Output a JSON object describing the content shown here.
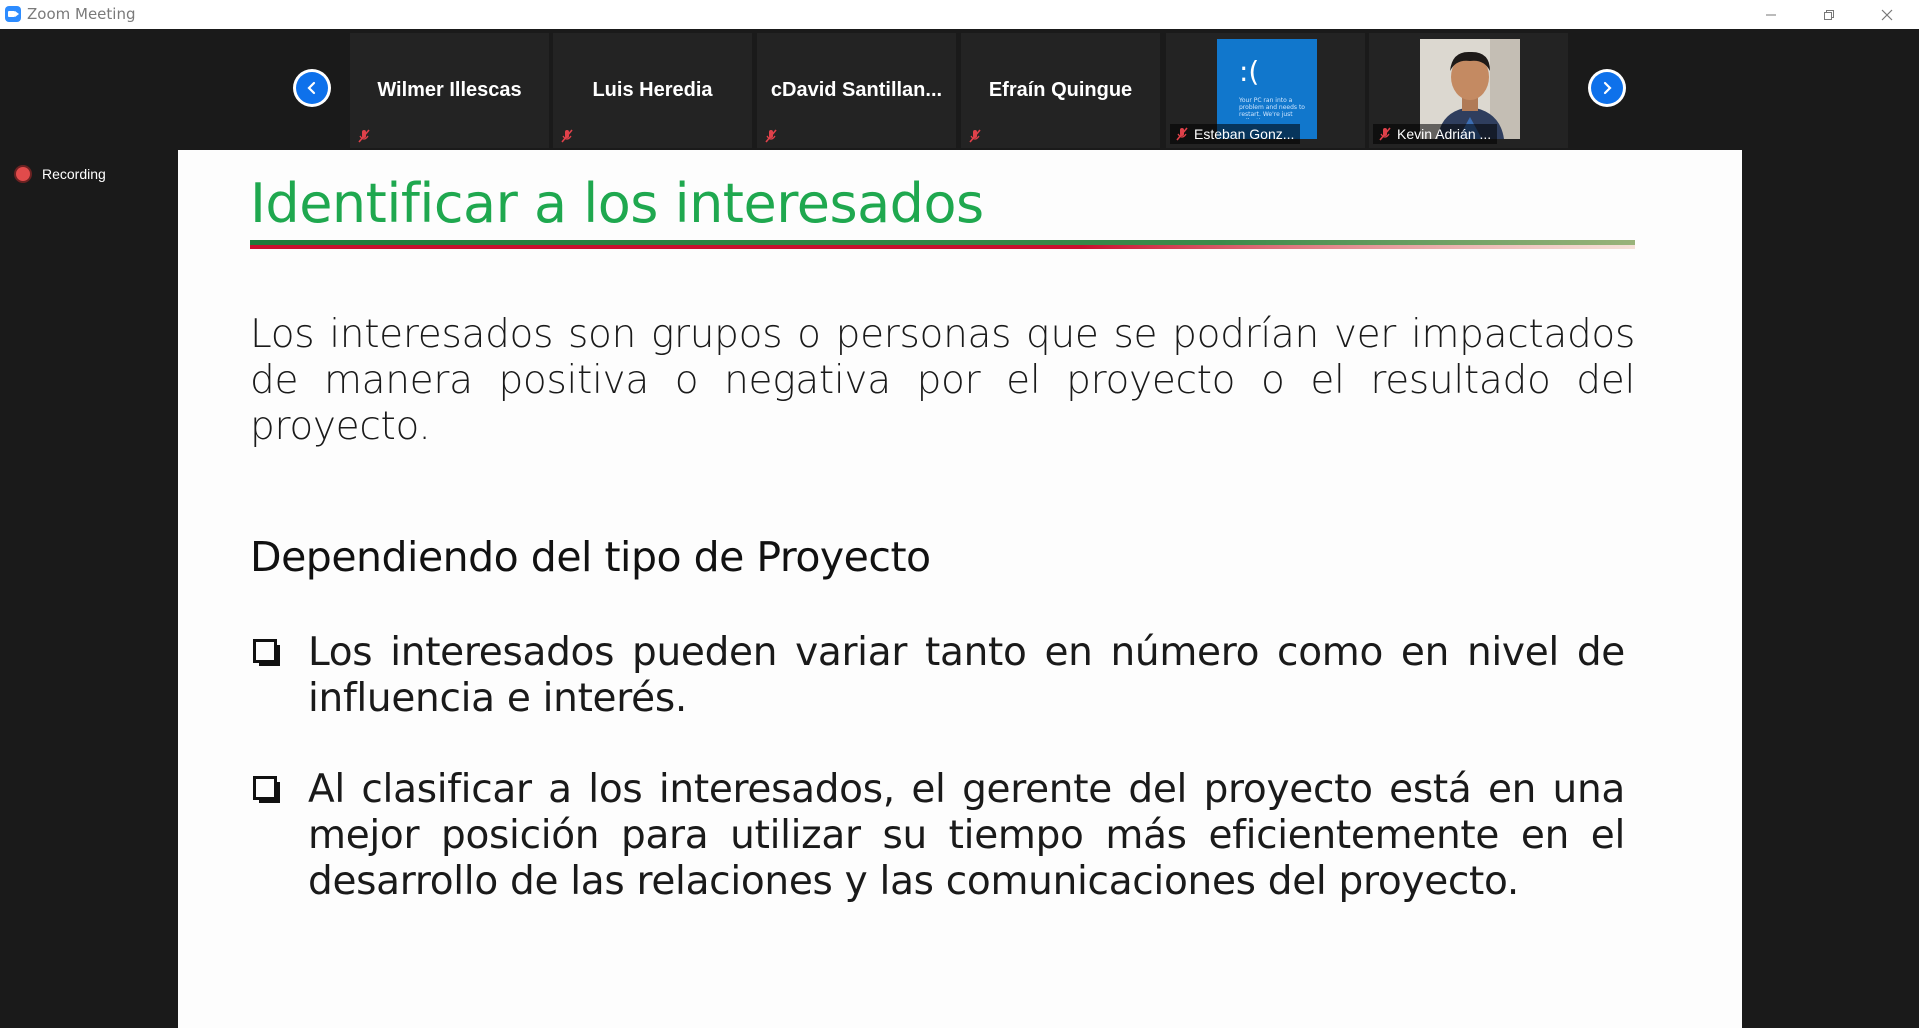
{
  "window": {
    "title": "Zoom Meeting"
  },
  "participants": [
    {
      "name": "Wilmer Illescas"
    },
    {
      "name": "Luis Heredia"
    },
    {
      "name": "cDavid  Santillan..."
    },
    {
      "name": "Efraín Quingue"
    },
    {
      "label": "Esteban Gonz...",
      "screen_face": ":(",
      "screen_text": "Your PC ran into a problem and needs to restart. We're just collecting some error info, and then we'll restart for you."
    },
    {
      "label": "Kevin Adrián ..."
    }
  ],
  "recording": {
    "label": "Recording"
  },
  "slide": {
    "title": "Identificar a los interesados",
    "paragraph": "Los interesados  son grupos o personas que se podrían ver impactados de manera positiva o negativa por el proyecto o el resultado del proyecto.",
    "subheading": "Dependiendo del tipo de Proyecto",
    "bullets": [
      "Los interesados pueden variar tanto en número como en nivel de influencia e interés.",
      "Al clasificar a los interesados, el gerente del proyecto está en una mejor posición para utilizar su tiempo más eficientemente en el desarrollo de las relaciones y las comunicaciones del proyecto."
    ]
  },
  "colors": {
    "accent": "#0e71eb",
    "title_green": "#1fa84f",
    "rule_red": "#c8102e",
    "recording_red": "#e14b4b"
  }
}
